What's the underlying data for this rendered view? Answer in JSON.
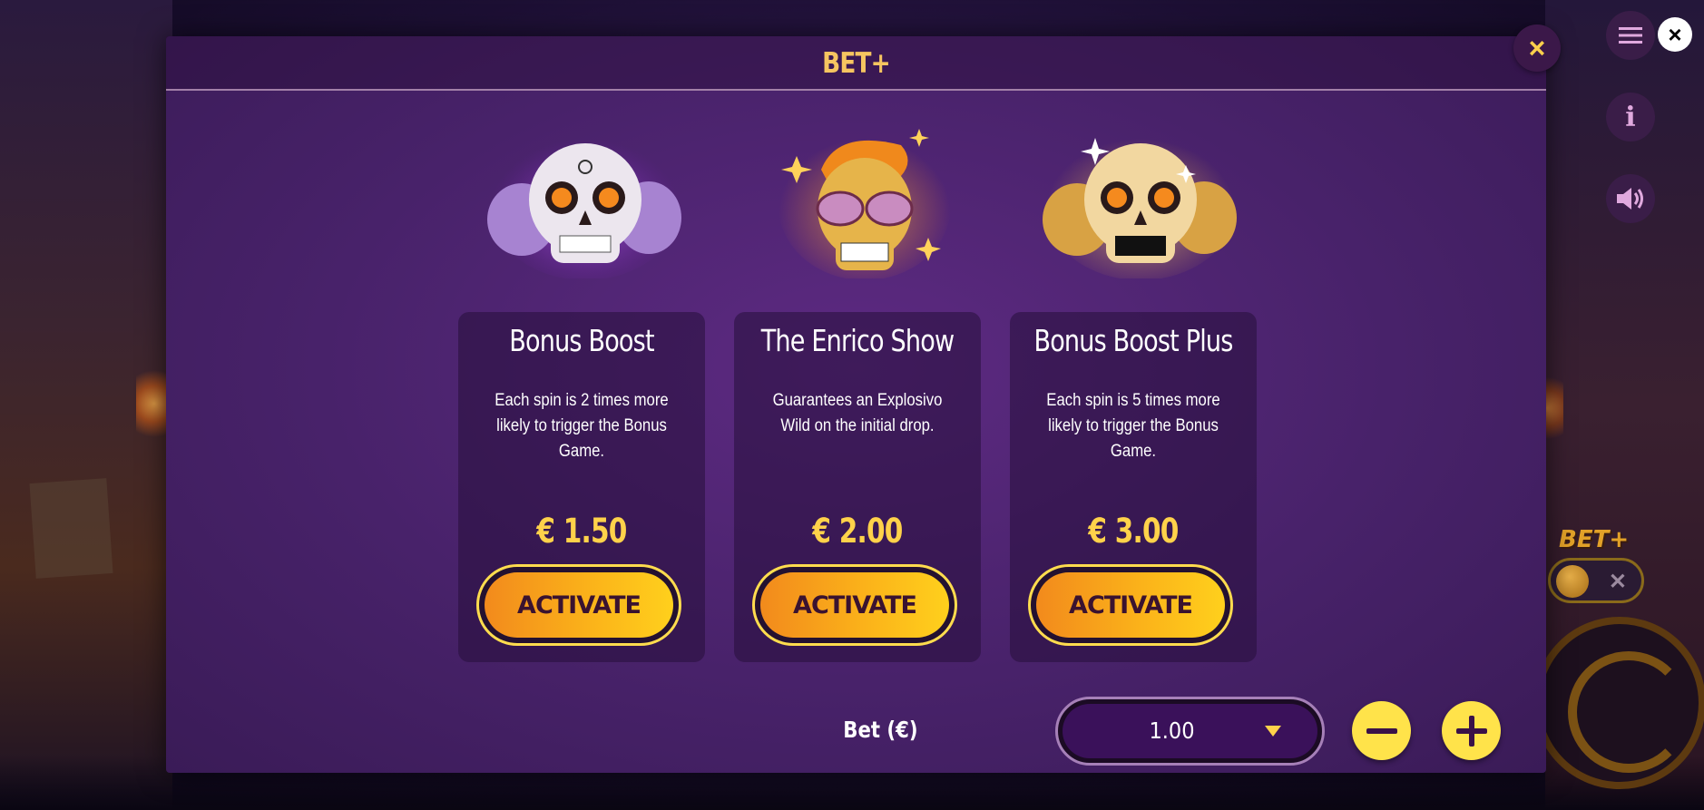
{
  "modal": {
    "title": "BET+",
    "close_icon": "close-icon",
    "features": [
      {
        "title": "Bonus Boost",
        "description": "Each spin is 2 times more likely to trigger the Bonus Game.",
        "price": "€ 1.50",
        "button": "ACTIVATE",
        "image_icon": "purple-skull-icon"
      },
      {
        "title": "The Enrico Show",
        "description": "Guarantees an Explosivo Wild on the initial drop.",
        "price": "€ 2.00",
        "button": "ACTIVATE",
        "image_icon": "sunglasses-skull-icon"
      },
      {
        "title": "Bonus Boost Plus",
        "description": "Each spin is 5 times more likely to trigger the Bonus Game.",
        "price": "€ 3.00",
        "button": "ACTIVATE",
        "image_icon": "golden-skull-icon"
      }
    ],
    "bet": {
      "label": "Bet (€)",
      "value": "1.00"
    }
  },
  "side_controls": {
    "betplus_label": "BET+",
    "toggle_off": "✕"
  },
  "colors": {
    "accent": "#ffd24a",
    "modal_bg": "#48226a",
    "button_gradient_start": "#f28a1c",
    "button_gradient_end": "#ffd01c"
  }
}
